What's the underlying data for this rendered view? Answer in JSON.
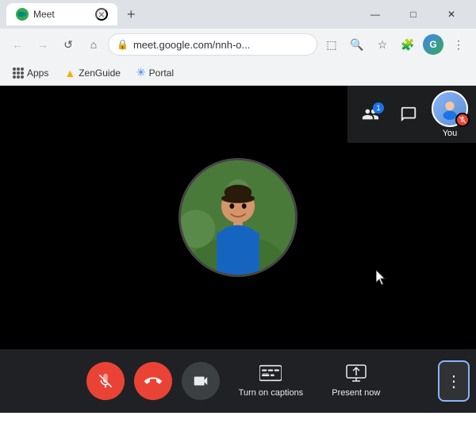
{
  "browser": {
    "tab": {
      "label": "Meet",
      "close_label": "×"
    },
    "new_tab_label": "+",
    "window_controls": {
      "minimize": "—",
      "maximize": "□",
      "close": "✕"
    },
    "nav": {
      "back_label": "←",
      "forward_label": "→",
      "reload_label": "↺",
      "home_label": "⌂",
      "url": "meet.google.com/nnh-o...",
      "lock_icon": "🔒"
    },
    "nav_icons": {
      "cast": "⬚",
      "zoom": "🔍",
      "star": "☆",
      "extension": "🧩",
      "menu": "⋮"
    },
    "bookmarks": [
      {
        "label": "Apps",
        "type": "grid"
      },
      {
        "label": "ZenGuide",
        "icon": "🔺"
      },
      {
        "label": "Portal",
        "icon": "✳"
      }
    ]
  },
  "meet": {
    "participants_count": "1",
    "you_label": "You",
    "muted": true
  },
  "controls": {
    "mute_label": "",
    "hangup_label": "",
    "camera_label": "",
    "captions_label": "Turn on captions",
    "present_label": "Present now",
    "more_label": "⋮"
  }
}
